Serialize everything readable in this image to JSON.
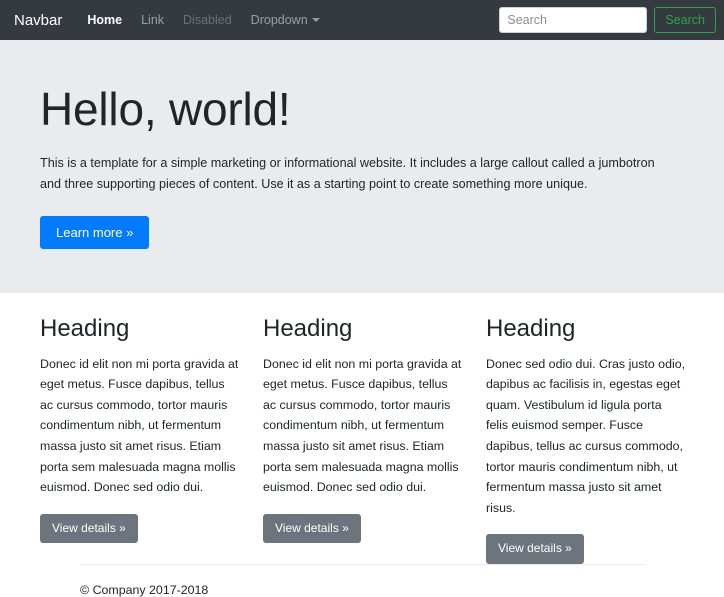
{
  "navbar": {
    "brand": "Navbar",
    "items": [
      {
        "label": "Home",
        "state": "active"
      },
      {
        "label": "Link",
        "state": "normal"
      },
      {
        "label": "Disabled",
        "state": "disabled"
      },
      {
        "label": "Dropdown",
        "state": "dropdown"
      }
    ],
    "search": {
      "placeholder": "Search",
      "value": "",
      "button_label": "Search"
    },
    "colors": {
      "background": "#343a40",
      "active_link": "#ffffff",
      "muted_link": "rgba(255,255,255,0.5)",
      "disabled_link": "rgba(255,255,255,0.27)",
      "search_button_accent": "#28a745"
    }
  },
  "jumbotron": {
    "title": "Hello, world!",
    "body": "This is a template for a simple marketing or informational website. It includes a large callout called a jumbotron and three supporting pieces of content. Use it as a starting point to create something more unique.",
    "cta_label": "Learn more »",
    "background": "#e9ecef",
    "cta_color": "#007bff"
  },
  "columns": [
    {
      "heading": "Heading",
      "body": "Donec id elit non mi porta gravida at eget metus. Fusce dapibus, tellus ac cursus commodo, tortor mauris condimentum nibh, ut fermentum massa justo sit amet risus. Etiam porta sem malesuada magna mollis euismod. Donec sed odio dui.",
      "button_label": "View details »"
    },
    {
      "heading": "Heading",
      "body": "Donec id elit non mi porta gravida at eget metus. Fusce dapibus, tellus ac cursus commodo, tortor mauris condimentum nibh, ut fermentum massa justo sit amet risus. Etiam porta sem malesuada magna mollis euismod. Donec sed odio dui.",
      "button_label": "View details »"
    },
    {
      "heading": "Heading",
      "body": "Donec sed odio dui. Cras justo odio, dapibus ac facilisis in, egestas eget quam. Vestibulum id ligula porta felis euismod semper. Fusce dapibus, tellus ac cursus commodo, tortor mauris condimentum nibh, ut fermentum massa justo sit amet risus.",
      "button_label": "View details »"
    }
  ],
  "footer": {
    "copyright": "© Company 2017-2018"
  }
}
